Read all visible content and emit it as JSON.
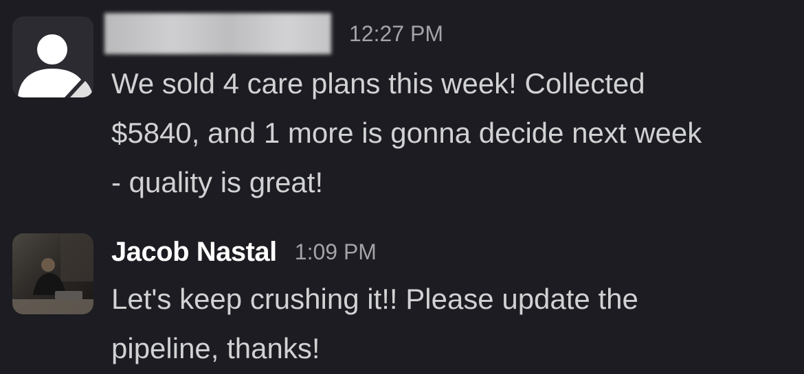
{
  "messages": [
    {
      "sender": "",
      "sender_redacted": true,
      "avatar": "generic-user-icon",
      "time": "12:27 PM",
      "text": "We sold 4 care plans this week! Collected\n$5840, and 1 more is gonna decide next week\n- quality is great!"
    },
    {
      "sender": "Jacob Nastal",
      "sender_redacted": false,
      "avatar": "user-photo",
      "time": "1:09 PM",
      "text": "Let's keep crushing it!! Please update the\npipeline, thanks!"
    }
  ],
  "colors": {
    "background": "#1c1c22",
    "text": "#d1d2d3",
    "name": "#ffffff",
    "timestamp": "#a3a4a7"
  }
}
